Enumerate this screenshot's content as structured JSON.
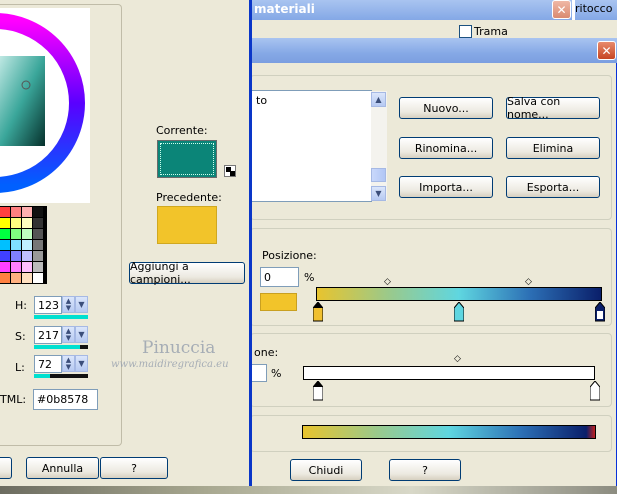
{
  "bg_title": "materiali",
  "bg_topright": "ritocco",
  "bg_checkbox": "Trama",
  "left": {
    "h_label": "H:",
    "h_value": "123",
    "s_label": "S:",
    "s_value": "217",
    "l_label": "L:",
    "l_value": "72",
    "html_label": "TML:",
    "html_value": "#0b8578",
    "corrente_label": "Corrente:",
    "corrente_color": "#0b8578",
    "precedente_label": "Precedente:",
    "precedente_color": "#f2c42a",
    "add_button": "Aggiungi a campioni...",
    "cancel_button": "Annulla",
    "help_button": "?"
  },
  "right": {
    "list_item": "to",
    "nuovo": "Nuovo...",
    "salva": "Salva con nome...",
    "rinomina": "Rinomina...",
    "elimina": "Elimina",
    "importa": "Importa...",
    "esporta": "Esporta...",
    "posizione_label": "Posizione:",
    "posizione_value": "0",
    "percent": "%",
    "opacity_label": "one:",
    "opacity_percent": "%",
    "chiudi": "Chiudi",
    "help": "?"
  },
  "watermark": {
    "line1": "Pinuccia",
    "line2": "www.maidiregrafica.eu"
  },
  "colors": {
    "accent": "#0b8578",
    "title_bar": "#0054e3",
    "gold": "#f2c42a"
  }
}
